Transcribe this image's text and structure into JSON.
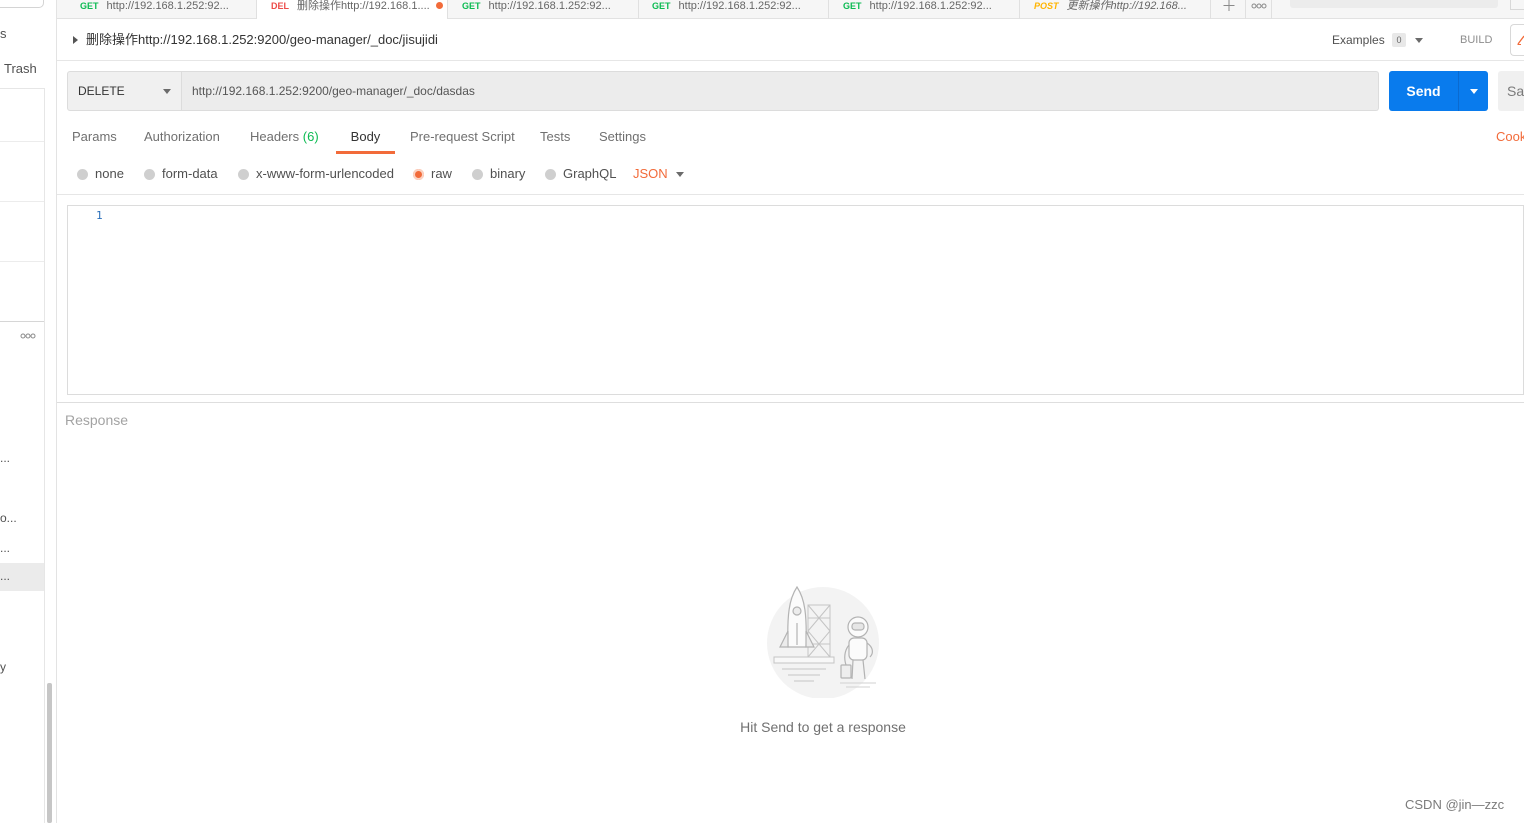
{
  "sidebar": {
    "top_label": "s",
    "trash_label": "Trash",
    "fragments": [
      "...",
      "o...",
      "...",
      "...",
      "y"
    ]
  },
  "tabs": [
    {
      "method": "GET",
      "title": "http://192.168.1.252:92..."
    },
    {
      "method": "DEL",
      "title": "删除操作http://192.168.1...."
    },
    {
      "method": "GET",
      "title": "http://192.168.1.252:92..."
    },
    {
      "method": "GET",
      "title": "http://192.168.1.252:92..."
    },
    {
      "method": "GET",
      "title": "http://192.168.1.252:92..."
    },
    {
      "method": "POST",
      "title": "更新操作http://192.168..."
    }
  ],
  "request": {
    "name": "删除操作http://192.168.1.252:9200/geo-manager/_doc/jisujidi",
    "examples_label": "Examples",
    "examples_count": "0",
    "build_label": "BUILD",
    "method": "DELETE",
    "url": "http://192.168.1.252:9200/geo-manager/_doc/dasdas",
    "send_label": "Send",
    "save_label": "Sa"
  },
  "request_tabs": {
    "params": "Params",
    "authorization": "Authorization",
    "headers": "Headers",
    "headers_count": "(6)",
    "body": "Body",
    "pre_request": "Pre-request Script",
    "tests": "Tests",
    "settings": "Settings",
    "cookies": "Cook"
  },
  "body_types": {
    "none": "none",
    "form_data": "form-data",
    "urlencoded": "x-www-form-urlencoded",
    "raw": "raw",
    "binary": "binary",
    "graphql": "GraphQL",
    "format": "JSON"
  },
  "editor": {
    "line_numbers": [
      "1"
    ]
  },
  "response": {
    "label": "Response",
    "empty_message": "Hit Send to get a response"
  },
  "watermark": "CSDN @jin—zzc",
  "colors": {
    "accent": "#f26b3a",
    "send": "#097bed",
    "get": "#0cbb52",
    "delete": "#ed4b48",
    "post": "#ffb400"
  },
  "icons": {
    "collapse": "caret-right-icon",
    "dropdown": "chevron-down-icon",
    "new_tab": "plus-icon",
    "more": "more-icon",
    "edit": "pencil-icon",
    "empty_state": "rocket-illustration"
  }
}
